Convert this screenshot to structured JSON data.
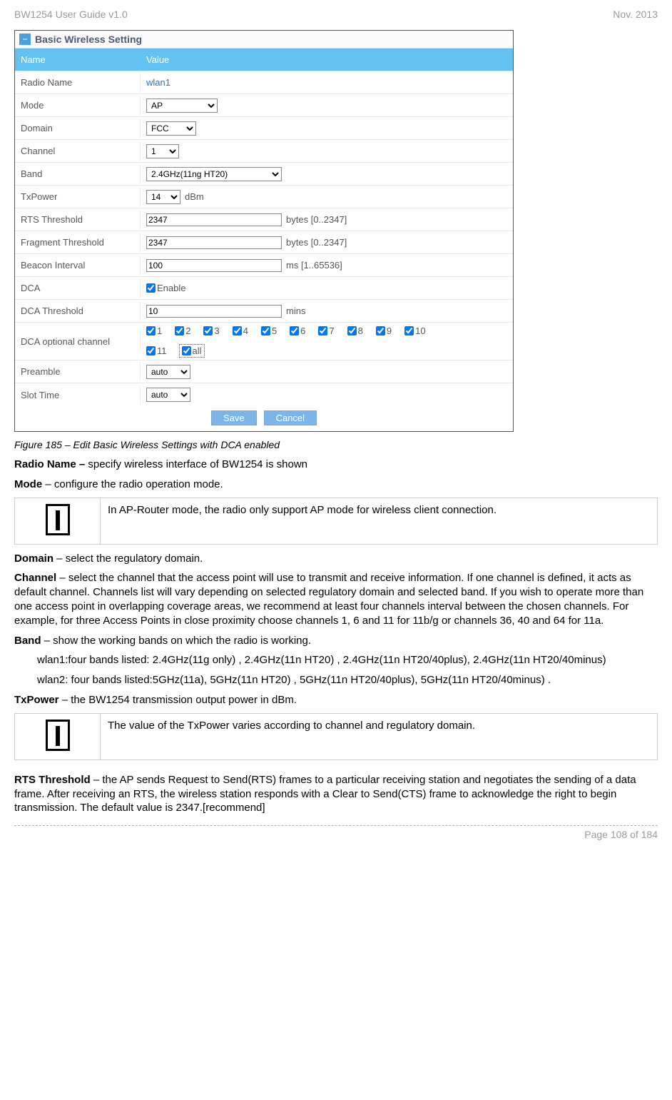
{
  "header": {
    "left": "BW1254 User Guide v1.0",
    "right": "Nov.  2013"
  },
  "panel": {
    "title": "Basic Wireless Setting",
    "cols": {
      "name": "Name",
      "value": "Value"
    },
    "rows": {
      "radio_name": {
        "label": "Radio Name",
        "value": "wlan1"
      },
      "mode": {
        "label": "Mode",
        "value": "AP"
      },
      "domain": {
        "label": "Domain",
        "value": "FCC"
      },
      "channel": {
        "label": "Channel",
        "value": "1"
      },
      "band": {
        "label": "Band",
        "value": "2.4GHz(11ng HT20)"
      },
      "txpower": {
        "label": "TxPower",
        "value": "14",
        "unit": "dBm"
      },
      "rts": {
        "label": "RTS Threshold",
        "value": "2347",
        "hint": "bytes [0..2347]"
      },
      "frag": {
        "label": "Fragment Threshold",
        "value": "2347",
        "hint": "bytes [0..2347]"
      },
      "beacon": {
        "label": "Beacon Interval",
        "value": "100",
        "hint": "ms [1..65536]"
      },
      "dca": {
        "label": "DCA",
        "enable": "Enable"
      },
      "dca_thr": {
        "label": "DCA Threshold",
        "value": "10",
        "hint": "mins"
      },
      "dca_ch": {
        "label": "DCA optional channel",
        "all_label": "all",
        "opts": [
          "1",
          "2",
          "3",
          "4",
          "5",
          "6",
          "7",
          "8",
          "9",
          "10",
          "11"
        ]
      },
      "preamble": {
        "label": "Preamble",
        "value": "auto"
      },
      "slot": {
        "label": "Slot Time",
        "value": "auto"
      }
    },
    "save": "Save",
    "cancel": "Cancel"
  },
  "caption": "Figure 185 – Edit Basic Wireless Settings with DCA enabled",
  "body": {
    "radio_name": {
      "t": "Radio Name – ",
      "d": "specify wireless interface of BW1254 is shown"
    },
    "mode": {
      "t": "Mode",
      "d": " – configure the radio operation mode."
    },
    "info1": "In AP-Router mode, the radio only support AP mode for wireless client connection.",
    "domain": {
      "t": "Domain",
      "d": " – select the regulatory domain."
    },
    "channel": {
      "t": "Channel",
      "d": " – select the channel that the access point will use to transmit and receive information. If one channel is defined, it acts as default channel. Channels list will vary depending on selected regulatory domain and selected band. If you wish to operate more than one access point in overlapping coverage areas, we recommend at least four channels interval between the chosen channels. For example, for three Access Points in close proximity choose channels 1, 6 and 11 for 11b/g or channels 36, 40 and 64 for 11a."
    },
    "band": {
      "t": "Band",
      "d": " – show the working bands on which the radio is working."
    },
    "band_w1": "wlan1:four bands listed: 2.4GHz(11g only) , 2.4GHz(11n HT20) , 2.4GHz(11n HT20/40plus), 2.4GHz(11n HT20/40minus)",
    "band_w2": "wlan2: four bands listed:5GHz(11a), 5GHz(11n HT20) , 5GHz(11n HT20/40plus), 5GHz(11n HT20/40minus) .",
    "txpower": {
      "t": "TxPower ",
      "d": " – the BW1254 transmission output power in dBm."
    },
    "info2": "The value of the TxPower varies according to channel and regulatory domain.",
    "rts": {
      "t": "RTS Threshold",
      "d": " – the AP sends Request to Send(RTS) frames to a particular receiving station and negotiates the sending of a data frame. After receiving an RTS, the wireless station responds with a Clear to Send(CTS) frame to acknowledge the right to begin transmission. The default value is 2347.[recommend]"
    }
  },
  "footer": "Page 108 of 184"
}
